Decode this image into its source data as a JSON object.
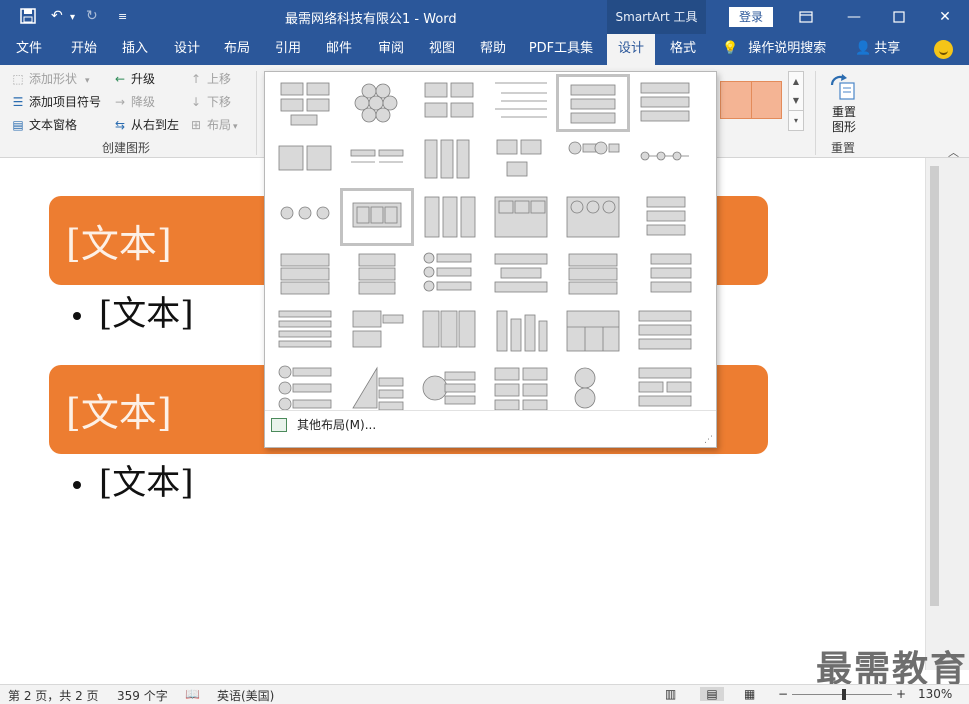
{
  "titlebar": {
    "doc_title": "最需网络科技有限公1  -  Word",
    "context_tab": "SmartArt 工具",
    "login": "登录",
    "qat": {
      "save_icon": "save-icon",
      "undo_icon": "undo-icon",
      "redo_icon": "redo-icon",
      "customize_icon": "customize-qat-icon"
    },
    "controls": {
      "restore_ribbon_icon": "ribbon-display-icon",
      "minimize_icon": "minimize-icon",
      "maximize_icon": "maximize-icon",
      "close_icon": "close-icon"
    }
  },
  "tabs": [
    "文件",
    "开始",
    "插入",
    "设计",
    "布局",
    "引用",
    "邮件",
    "审阅",
    "视图",
    "帮助",
    "PDF工具集",
    "设计",
    "格式"
  ],
  "active_tab_index": 11,
  "tell_me": "操作说明搜索",
  "share": "共享",
  "ribbon": {
    "create_graphic": {
      "add_shape": "添加形状",
      "add_bullet": "添加项目符号",
      "text_pane": "文本窗格",
      "promote": "升级",
      "demote": "降级",
      "right_to_left": "从右到左",
      "move_up": "上移",
      "move_down": "下移",
      "layout": "布局",
      "group_label": "创建图形"
    },
    "reset": {
      "button_line1": "重置",
      "button_line2": "图形",
      "group_label": "重置"
    }
  },
  "document": {
    "box1_text": "[文本]",
    "bullet1": "[文本]",
    "box2_text": "[文本]",
    "bullet2": "[文本]",
    "accent_color": "#ed7d31"
  },
  "gallery": {
    "rows": 6,
    "cols": 6,
    "selected_cells": [
      4,
      13
    ],
    "more_layouts": "其他布局(M)..."
  },
  "watermark": "最需教育",
  "statusbar": {
    "page": "第 2 页，共 2 页",
    "words": "359 个字",
    "language": "英语(美国)",
    "zoom": "130%",
    "zoom_out": "−",
    "zoom_in": "+"
  }
}
